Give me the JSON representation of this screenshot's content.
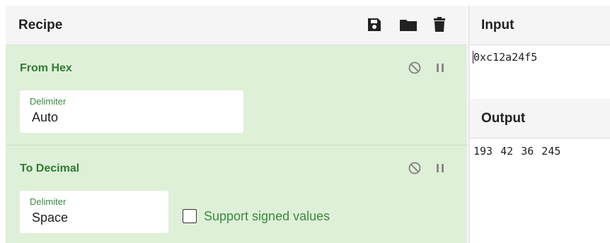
{
  "recipe": {
    "title": "Recipe",
    "icons": [
      "save-icon",
      "folder-icon",
      "trash-icon"
    ]
  },
  "operations": [
    {
      "title": "From Hex",
      "icons": [
        "disable-icon",
        "pause-icon"
      ],
      "delimiter_label": "Delimiter",
      "delimiter_value": "Auto"
    },
    {
      "title": "To Decimal",
      "icons": [
        "disable-icon",
        "pause-icon"
      ],
      "delimiter_label": "Delimiter",
      "delimiter_value": "Space",
      "checkbox_label": "Support signed values",
      "checkbox_checked": false
    }
  ],
  "input": {
    "title": "Input",
    "value": "0xc12a24f5"
  },
  "output": {
    "title": "Output",
    "value": "193 42 36 245"
  },
  "colors": {
    "operation_bg": "#dff0d8",
    "operation_text": "#2f7d32",
    "header_bg": "#f5f5f5"
  }
}
